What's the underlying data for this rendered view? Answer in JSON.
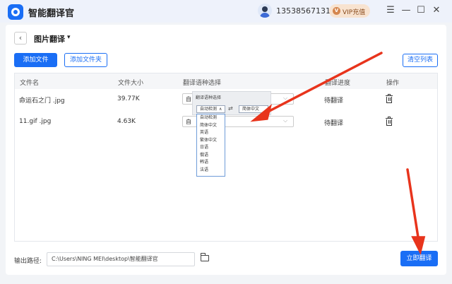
{
  "app": {
    "title": "智能翻译官",
    "phone": "13538567131",
    "vip_label": "VIP充值",
    "vip_icon": "V",
    "brand_color": "#1a6ef5"
  },
  "window_controls": {
    "menu": "☰",
    "minimize": "—",
    "maximize": "☐",
    "close": "✕"
  },
  "page": {
    "back": "‹",
    "title": "图片翻译",
    "caret": "▾"
  },
  "toolbar": {
    "add_file": "添加文件",
    "add_folder": "添加文件夹",
    "clear_list": "清空列表"
  },
  "table": {
    "headers": [
      "文件名",
      "文件大小",
      "翻译语种选择",
      "翻译进度",
      "操作"
    ],
    "rows": [
      {
        "name": "命运石之门 .jpg",
        "size": "39.77K",
        "lang_partial": "自",
        "status": "待翻译"
      },
      {
        "name": "11.gif .jpg",
        "size": "4.63K",
        "lang_partial": "自",
        "status": "待翻译"
      }
    ]
  },
  "lang_dropdown": {
    "header": "翻译语种选择",
    "source_selected": "自动检测",
    "source_caret": "∧",
    "swap": "⇄",
    "target_selected": "简体中文",
    "options": [
      "自动检测",
      "简体中文",
      "英语",
      "繁体中文",
      "日语",
      "俄语",
      "韩语",
      "法语",
      "德语",
      "意大利语"
    ]
  },
  "footer": {
    "output_label": "输出路径:",
    "output_path": "C:\\Users\\NING MEI\\desktop\\智能翻译官",
    "translate_now": "立即翻译"
  },
  "annotation_color": "#e8341c"
}
